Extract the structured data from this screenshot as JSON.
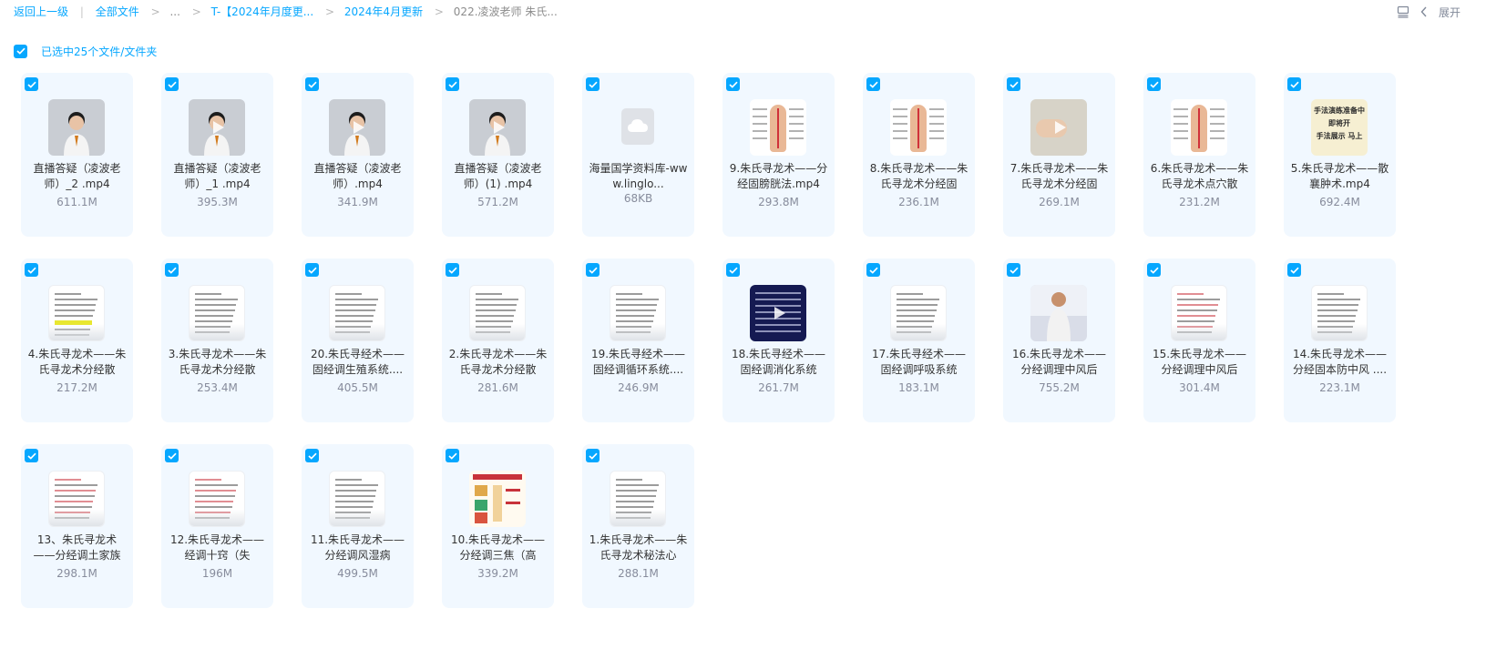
{
  "breadcrumb": {
    "back": "返回上一级",
    "all_files": "全部文件",
    "ellipsis": "...",
    "folder1": "T-【2024年月度更...",
    "folder2": "2024年4月更新",
    "current": "022.凌波老师 朱氏..."
  },
  "toolbar": {
    "expand": "展开",
    "list_icon": "list-view-icon",
    "chevron_icon": "chevron-left-icon"
  },
  "selection": {
    "label": "已选中25个文件/文件夹"
  },
  "colors": {
    "accent": "#06a7ff",
    "card_bg": "#f1f8ff"
  },
  "files": [
    {
      "name": "直播答疑（凌波老师）_2 .mp4",
      "size": "611.1M",
      "thumb": "video"
    },
    {
      "name": "直播答疑（凌波老师）_1 .mp4",
      "size": "395.3M",
      "thumb": "video"
    },
    {
      "name": "直播答疑（凌波老师）.mp4",
      "size": "341.9M",
      "thumb": "video"
    },
    {
      "name": "直播答疑（凌波老师）(1) .mp4",
      "size": "571.2M",
      "thumb": "video"
    },
    {
      "name": "海量国学资料库-www.linglo...",
      "size": "68KB",
      "thumb": "cloud"
    },
    {
      "name": "9.朱氏寻龙术——分经固膀胱法.mp4",
      "size": "293.8M",
      "thumb": "anat"
    },
    {
      "name": "8.朱氏寻龙术——朱氏寻龙术分经固",
      "size": "236.1M",
      "thumb": "anat"
    },
    {
      "name": "7.朱氏寻龙术——朱氏寻龙术分经固",
      "size": "269.1M",
      "thumb": "hands"
    },
    {
      "name": "6.朱氏寻龙术——朱氏寻龙术点穴散",
      "size": "231.2M",
      "thumb": "anat"
    },
    {
      "name": "5.朱氏寻龙术——散襄肿术.mp4",
      "size": "692.4M",
      "thumb": "poster"
    },
    {
      "name": "4.朱氏寻龙术——朱氏寻龙术分经散",
      "size": "217.2M",
      "thumb": "doc-yellow"
    },
    {
      "name": "3.朱氏寻龙术——朱氏寻龙术分经散",
      "size": "253.4M",
      "thumb": "doc"
    },
    {
      "name": "20.朱氏寻经术——固经调生殖系统....",
      "size": "405.5M",
      "thumb": "doc"
    },
    {
      "name": "2.朱氏寻龙术——朱氏寻龙术分经散",
      "size": "281.6M",
      "thumb": "doc"
    },
    {
      "name": "19.朱氏寻经术——固经调循环系统....",
      "size": "246.9M",
      "thumb": "doc"
    },
    {
      "name": "18.朱氏寻经术——固经调消化系统",
      "size": "261.7M",
      "thumb": "dark"
    },
    {
      "name": "17.朱氏寻经术——固经调呼吸系统",
      "size": "183.1M",
      "thumb": "doc"
    },
    {
      "name": "16.朱氏寻龙术——分经调理中风后",
      "size": "755.2M",
      "thumb": "lecture"
    },
    {
      "name": "15.朱氏寻龙术——分经调理中风后",
      "size": "301.4M",
      "thumb": "doc-red"
    },
    {
      "name": "14.朱氏寻龙术——分经固本防中风 ....",
      "size": "223.1M",
      "thumb": "doc"
    },
    {
      "name": "13、朱氏寻龙术——分经调土家族",
      "size": "298.1M",
      "thumb": "doc-red"
    },
    {
      "name": "12.朱氏寻龙术——经调十窍（失",
      "size": "196M",
      "thumb": "doc-red"
    },
    {
      "name": "11.朱氏寻龙术——分经调风湿病",
      "size": "499.5M",
      "thumb": "doc"
    },
    {
      "name": "10.朱氏寻龙术——分经调三焦（高",
      "size": "339.2M",
      "thumb": "info"
    },
    {
      "name": "1.朱氏寻龙术——朱氏寻龙术秘法心",
      "size": "288.1M",
      "thumb": "doc"
    }
  ],
  "poster_text": {
    "line1": "手法演练准备中",
    "line2": "即将开",
    "line3": "手法展示 马上"
  }
}
